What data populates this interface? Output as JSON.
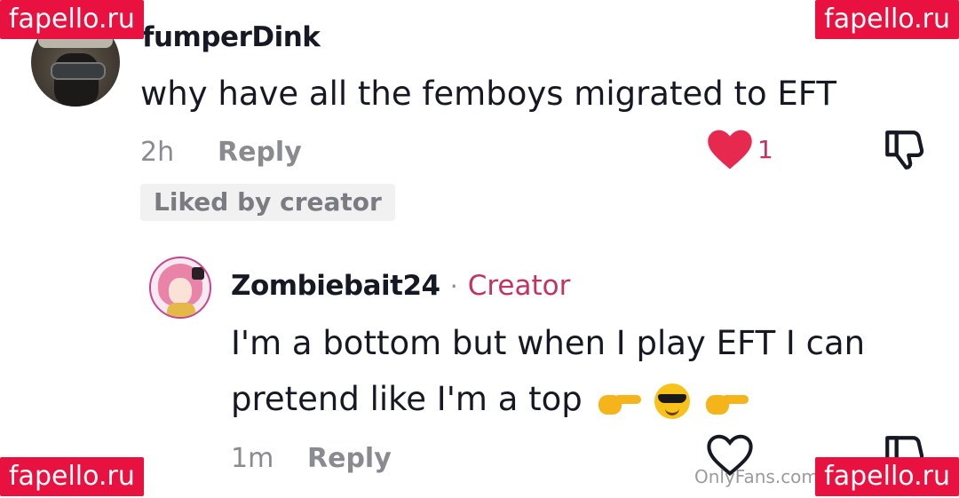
{
  "watermarks": {
    "top_left": "fapello.ru",
    "top_right": "fapello.ru",
    "bottom_left": "fapello.ru",
    "bottom_right": "fapello.ru",
    "onlyfans": "OnlyFans.com/"
  },
  "comment": {
    "username": "fumperDink",
    "text": "why have all the femboys migrated to EFT",
    "time": "2h",
    "reply_label": "Reply",
    "like_count": "1",
    "liked_badge": "Liked by creator",
    "liked": true
  },
  "reply": {
    "username": "Zombiebait24",
    "separator": "·",
    "creator_tag": "Creator",
    "text_line1": "I'm a bottom but when I play EFT I can",
    "text_line2": "pretend like I'm a top",
    "time": "1m",
    "reply_label": "Reply",
    "liked": false
  },
  "colors": {
    "like_red": "#e8294f",
    "creator_pink": "#c4325f",
    "watermark_red": "#e8113f",
    "muted_gray": "#8a8b91"
  },
  "icons": [
    "avatar",
    "heart-filled-icon",
    "heart-outline-icon",
    "dislike-icon",
    "pointing-right-emoji",
    "sunglasses-emoji"
  ]
}
